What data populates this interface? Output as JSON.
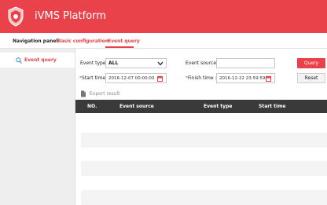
{
  "header": {
    "title": "iVMS Platform",
    "logo_icon": "shield-icon"
  },
  "nav": {
    "items": [
      {
        "label": "Navigation panel"
      },
      {
        "label": "Basic configuration"
      },
      {
        "label": "Event query"
      }
    ],
    "active": "Event query"
  },
  "sidebar": {
    "items": [
      {
        "label": "Event query",
        "icon": "search-icon"
      }
    ]
  },
  "filters": {
    "event_type_label": "Event type :",
    "event_type_value": "ALL",
    "event_source_label": "Event source :",
    "event_source_value": "",
    "start_time_label": "Start time :",
    "start_time_value": "2016-12-07 00:00:00",
    "finish_time_label": "Finish time :",
    "finish_time_value": "2016-12-22 23:59:59",
    "required_mark": "*"
  },
  "buttons": {
    "query": "Query",
    "reset": "Reset"
  },
  "export": {
    "label": "Export result"
  },
  "table": {
    "columns": [
      "NO.",
      "Event source",
      "Event type",
      "Start time"
    ],
    "rows": []
  },
  "colors": {
    "accent": "#e9424a",
    "table_header": "#3a3a3a"
  }
}
